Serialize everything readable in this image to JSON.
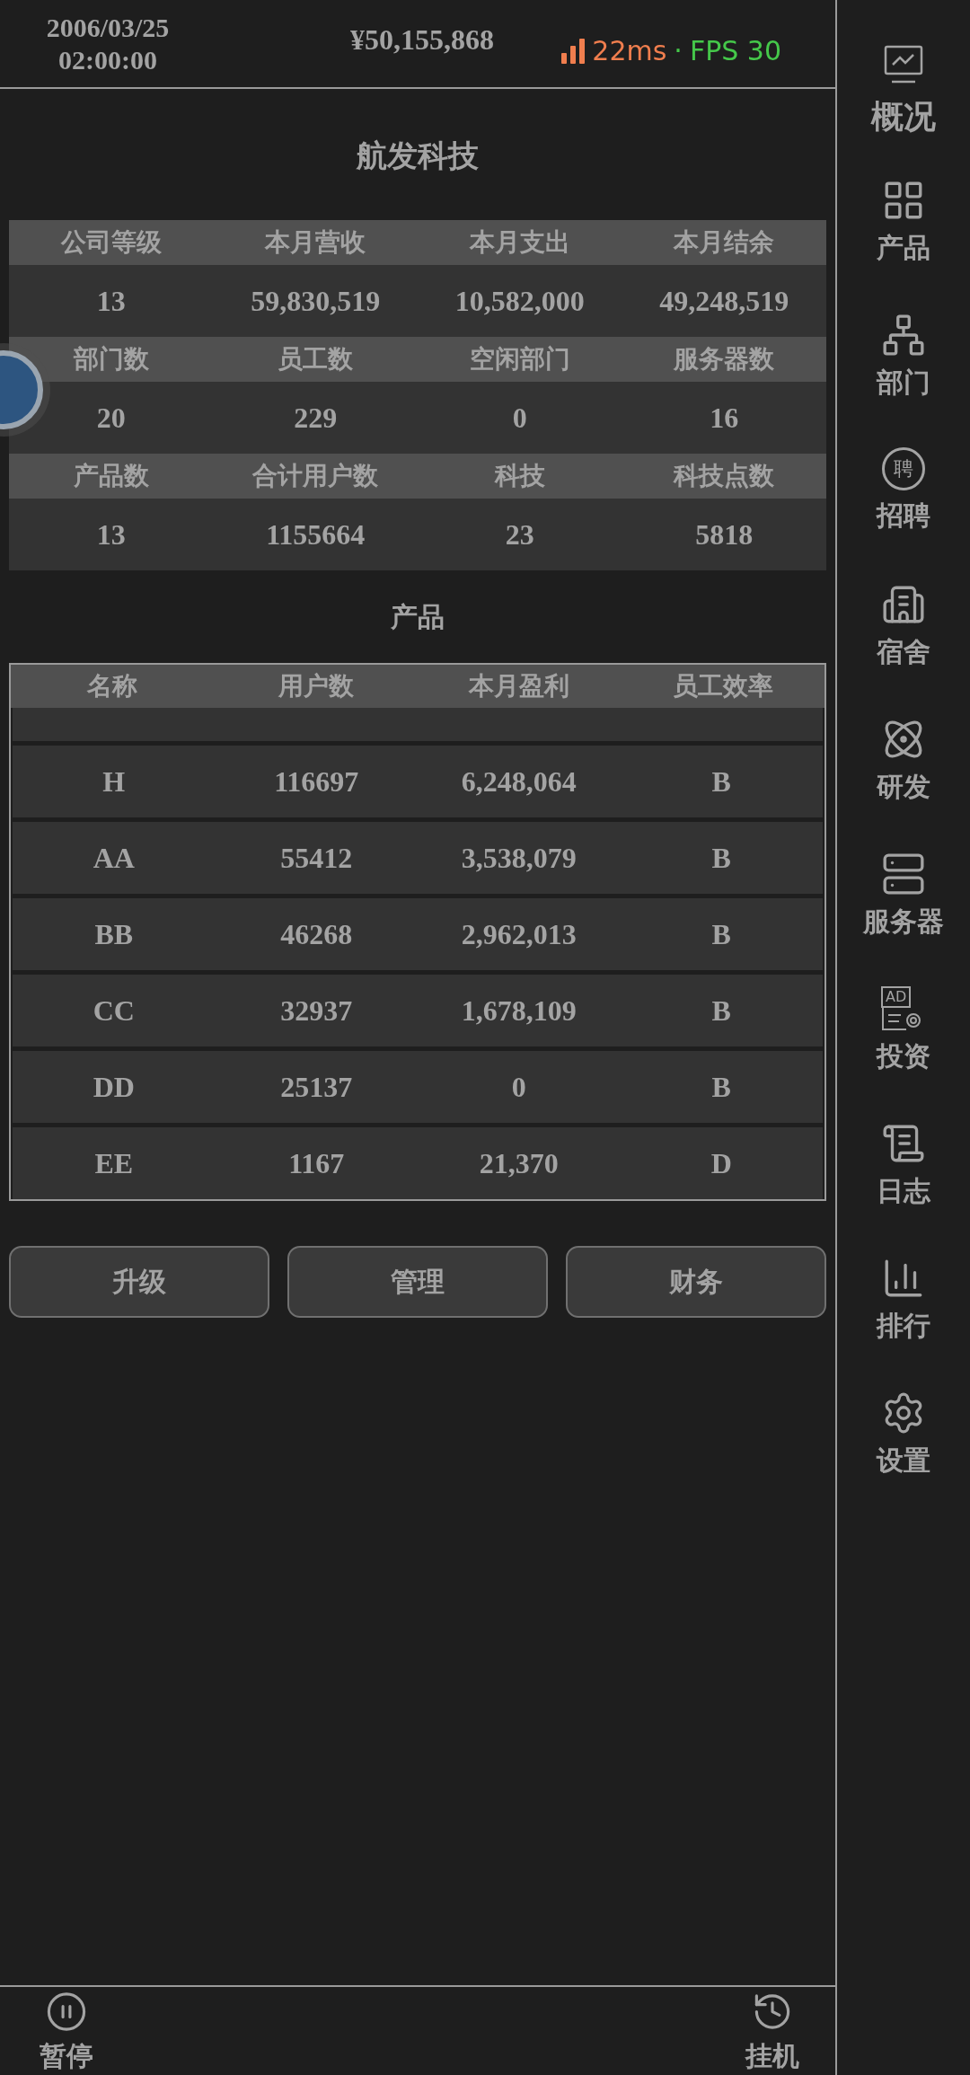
{
  "status_bar": {
    "date": "2006/03/25",
    "time": "02:00:00",
    "money": "¥50,155,868",
    "latency": "22ms",
    "separator": "·",
    "fps": "FPS 30"
  },
  "company": {
    "name": "航发科技"
  },
  "stats": [
    {
      "headers": [
        "公司等级",
        "本月营收",
        "本月支出",
        "本月结余"
      ],
      "values": [
        "13",
        "59,830,519",
        "10,582,000",
        "49,248,519"
      ]
    },
    {
      "headers": [
        "部门数",
        "员工数",
        "空闲部门",
        "服务器数"
      ],
      "values": [
        "20",
        "229",
        "0",
        "16"
      ]
    },
    {
      "headers": [
        "产品数",
        "合计用户数",
        "科技",
        "科技点数"
      ],
      "values": [
        "13",
        "1155664",
        "23",
        "5818"
      ]
    }
  ],
  "products": {
    "title": "产品",
    "columns": [
      "名称",
      "用户数",
      "本月盈利",
      "员工效率"
    ],
    "rows": [
      [
        "H",
        "116697",
        "6,248,064",
        "B"
      ],
      [
        "AA",
        "55412",
        "3,538,079",
        "B"
      ],
      [
        "BB",
        "46268",
        "2,962,013",
        "B"
      ],
      [
        "CC",
        "32937",
        "1,678,109",
        "B"
      ],
      [
        "DD",
        "25137",
        "0",
        "B"
      ],
      [
        "EE",
        "1167",
        "21,370",
        "D"
      ]
    ]
  },
  "actions": [
    "升级",
    "管理",
    "财务"
  ],
  "sidebar": {
    "items": [
      {
        "kind": "monitor",
        "label": "概况",
        "selected": true
      },
      {
        "kind": "grid",
        "label": "产品",
        "selected": false
      },
      {
        "kind": "org",
        "label": "部门",
        "selected": false
      },
      {
        "kind": "badge",
        "label": "招聘",
        "icon_text": "聘",
        "selected": false
      },
      {
        "kind": "building",
        "label": "宿舍",
        "selected": false
      },
      {
        "kind": "atom",
        "label": "研发",
        "selected": false
      },
      {
        "kind": "server",
        "label": "服务器",
        "selected": false
      },
      {
        "kind": "ad",
        "label": "投资",
        "icon_text": "AD",
        "selected": false
      },
      {
        "kind": "log",
        "label": "日志",
        "selected": false
      },
      {
        "kind": "rank",
        "label": "排行",
        "selected": false
      },
      {
        "kind": "gear",
        "label": "设置",
        "selected": false
      }
    ]
  },
  "bottom": [
    {
      "kind": "pause",
      "label": "暂停"
    },
    {
      "kind": "idle",
      "label": "挂机"
    }
  ]
}
